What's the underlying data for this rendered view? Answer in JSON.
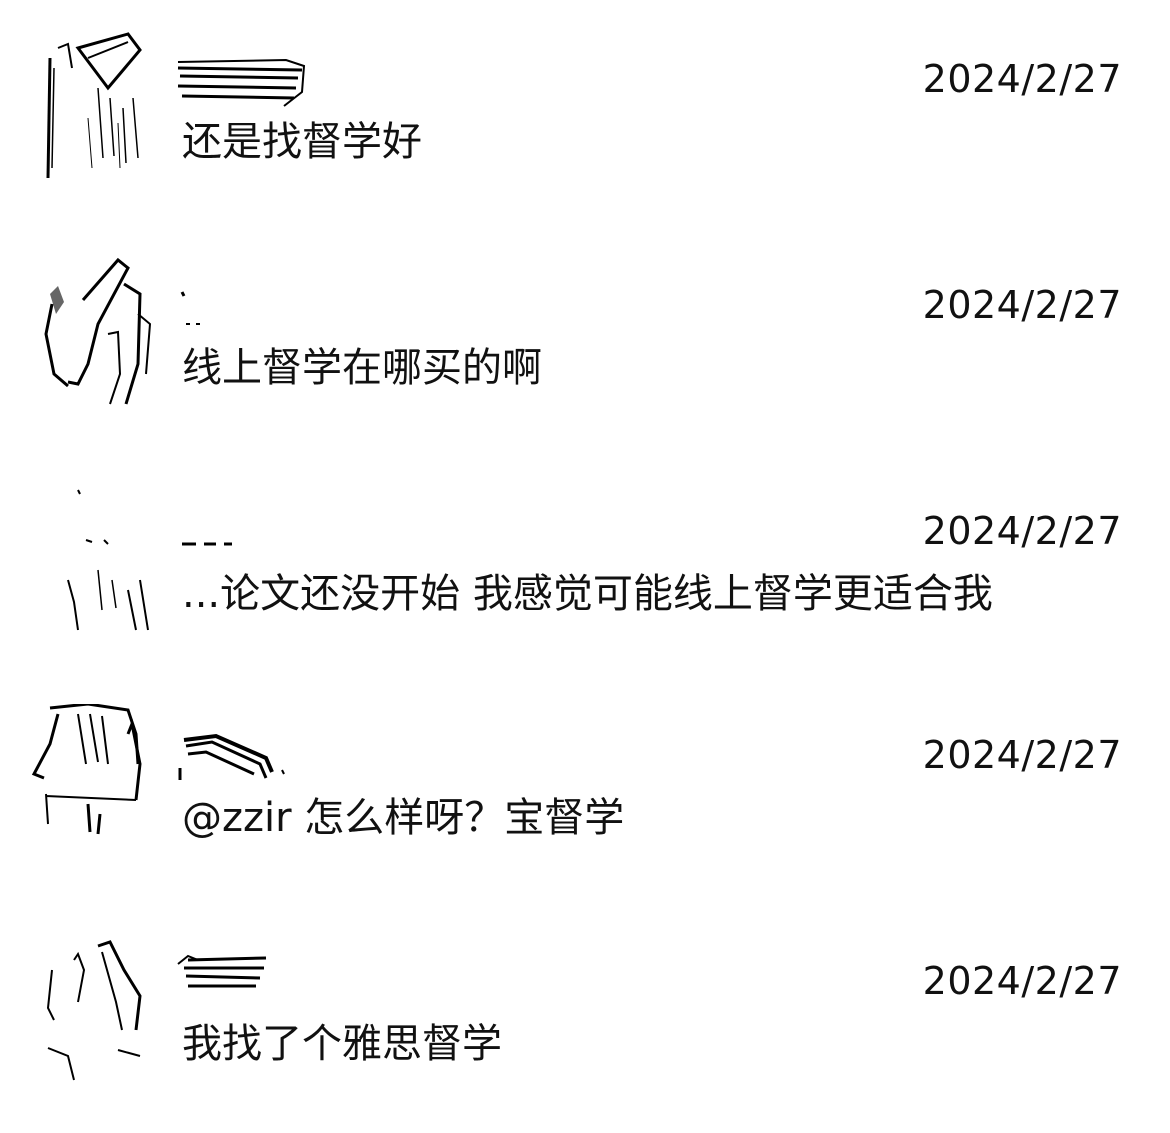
{
  "comments": [
    {
      "date": "2024/2/27",
      "text": "还是找督学好"
    },
    {
      "date": "2024/2/27",
      "text": "线上督学在哪买的啊"
    },
    {
      "date": "2024/2/27",
      "text": "...论文还没开始 我感觉可能线上督学更适合我"
    },
    {
      "date": "2024/2/27",
      "text": "@zzir 怎么样呀？宝督学"
    },
    {
      "date": "2024/2/27",
      "text": "我找了个雅思督学"
    }
  ],
  "colors": {
    "background": "#ffffff",
    "text": "#111111"
  }
}
